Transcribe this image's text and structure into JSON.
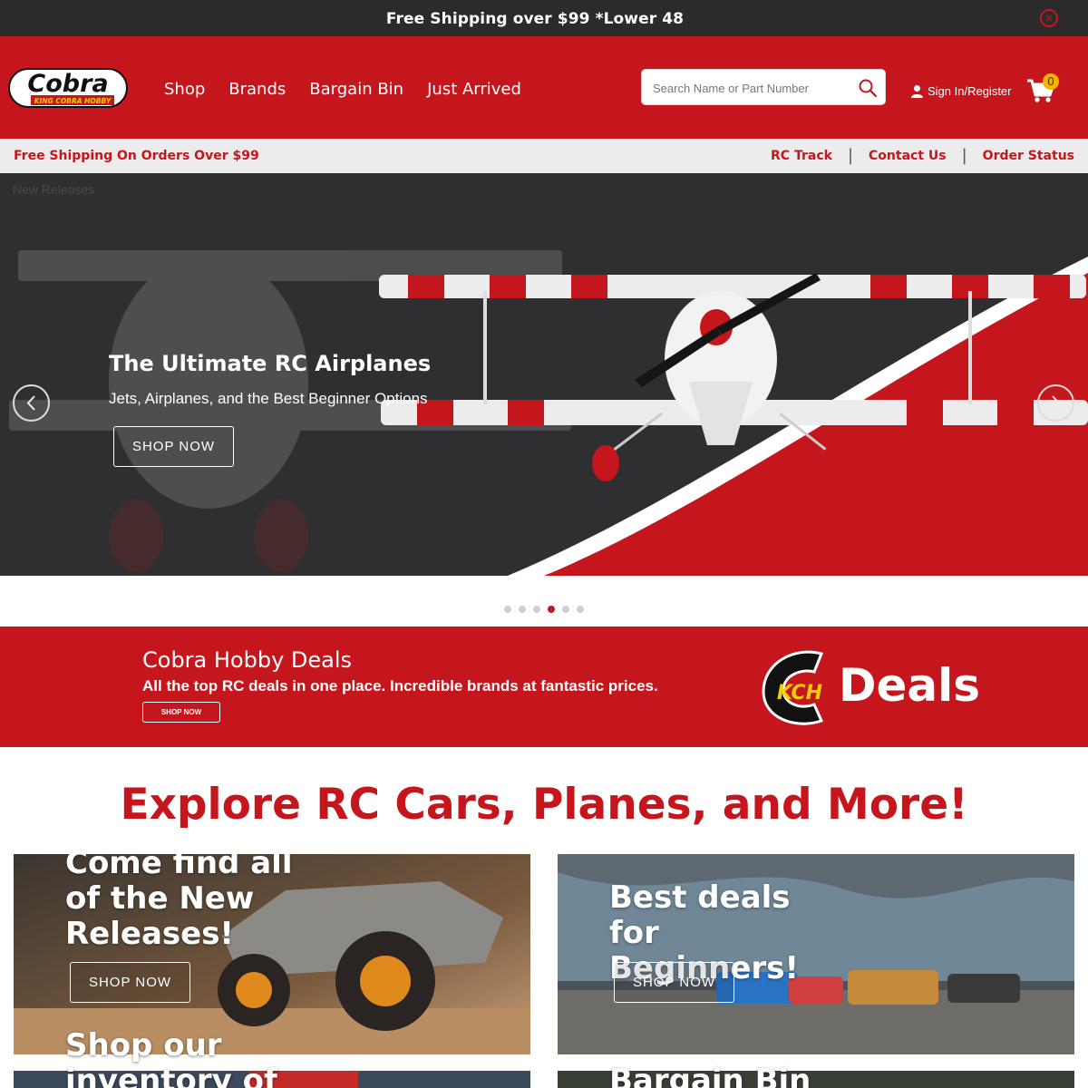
{
  "promo_bar": {
    "message": "Free Shipping over $99 *Lower 48",
    "close_glyph": "×"
  },
  "header": {
    "logo_name": "Cobra",
    "logo_tagline": "KING COBRA HOBBY",
    "nav": [
      "Shop",
      "Brands",
      "Bargain Bin",
      "Just Arrived"
    ],
    "search": {
      "placeholder": "Search Name or Part Number",
      "value": ""
    },
    "sign_in": "Sign In/Register",
    "cart_count": "0"
  },
  "sub_bar": {
    "shipping": "Free Shipping On Orders Over $99",
    "links": [
      "RC Track",
      "Contact Us",
      "Order Status"
    ],
    "separator": "|"
  },
  "hero": {
    "crumb": "New Releases",
    "title": "The Ultimate RC Airplanes",
    "subtitle": "Jets, Airplanes, and the Best Beginner Options",
    "button": "SHOP NOW",
    "slide_count": 6,
    "active_slide": 4
  },
  "deals_banner": {
    "title": "Cobra Hobby Deals",
    "subtitle": "All the top RC deals in one place. Incredible brands at fantastic prices.",
    "button": "SHOP NOW",
    "logo_word": "Deals",
    "logo_mark": "KCH"
  },
  "explore": {
    "heading": "Explore RC Cars, Planes, and More!",
    "tiles": [
      {
        "text": "Come find all of the New Releases!",
        "lines": [
          "Come find all",
          "of the New",
          "Releases!"
        ],
        "button": "SHOP NOW"
      },
      {
        "text": "Best deals for Beginners!",
        "lines": [
          "Best deals for",
          "Beginners!"
        ],
        "button": "SHOP NOW"
      },
      {
        "text": "Shop our inventory of",
        "lines": [
          "Shop our",
          "inventory of"
        ],
        "button": ""
      },
      {
        "text": "Bargain Bin",
        "lines": [
          "Bargain Bin"
        ],
        "button": ""
      }
    ]
  },
  "colors": {
    "brand_red": "#c4161c",
    "dark": "#2b2b2b",
    "light_bar": "#ececec",
    "badge": "#f4b400"
  },
  "icons": [
    "close-icon",
    "search-icon",
    "user-icon",
    "cart-icon",
    "chevron-left-icon",
    "chevron-right-icon"
  ]
}
